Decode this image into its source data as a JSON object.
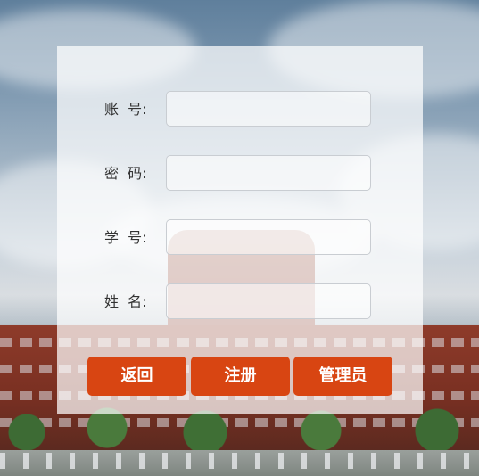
{
  "form": {
    "fields": [
      {
        "label": "账  号:",
        "value": ""
      },
      {
        "label": "密  码:",
        "value": ""
      },
      {
        "label": "学  号:",
        "value": ""
      },
      {
        "label": "姓  名:",
        "value": ""
      }
    ]
  },
  "buttons": {
    "back": "返回",
    "register": "注册",
    "admin": "管理员"
  },
  "colors": {
    "button": "#d84512",
    "panel": "rgba(255,255,255,0.72)"
  }
}
